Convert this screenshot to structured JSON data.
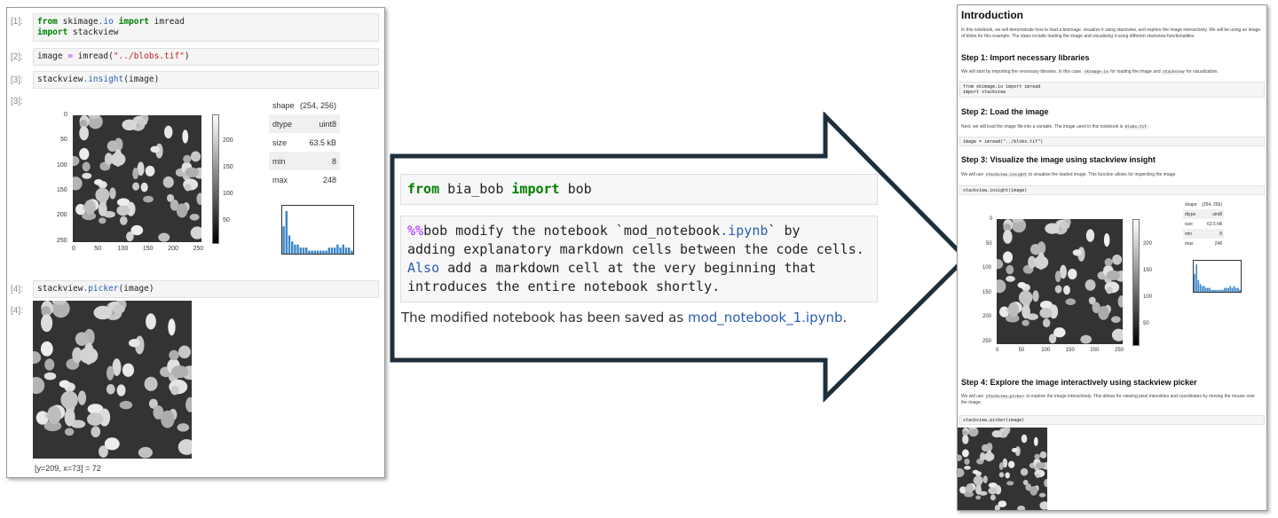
{
  "left_notebook": {
    "cells": [
      {
        "prompt": "[1]:",
        "lines": [
          [
            {
              "t": "from",
              "c": "kw"
            },
            {
              "t": " skimage"
            },
            {
              "t": ".io",
              "c": "mod"
            },
            {
              "t": " "
            },
            {
              "t": "import",
              "c": "kw"
            },
            {
              "t": " imread"
            }
          ],
          [
            {
              "t": "import",
              "c": "kw"
            },
            {
              "t": " stackview"
            }
          ]
        ]
      },
      {
        "prompt": "[2]:",
        "lines": [
          [
            {
              "t": "image "
            },
            {
              "t": "=",
              "c": "op"
            },
            {
              "t": " imread("
            },
            {
              "t": "\"../blobs.tif\"",
              "c": "str"
            },
            {
              "t": ")"
            }
          ]
        ]
      },
      {
        "prompt": "[3]:",
        "lines": [
          [
            {
              "t": "stackview"
            },
            {
              "t": ".insight",
              "c": "mod"
            },
            {
              "t": "(image)"
            }
          ]
        ]
      },
      {
        "prompt": "[4]:",
        "lines": [
          [
            {
              "t": "stackview"
            },
            {
              "t": ".picker",
              "c": "mod"
            },
            {
              "t": "(image)"
            }
          ]
        ]
      }
    ],
    "output_prompts": {
      "insight": "[3]:",
      "picker": "[4]:"
    },
    "insight_stats": [
      {
        "k": "shape",
        "v": "(254, 256)"
      },
      {
        "k": "dtype",
        "v": "uint8"
      },
      {
        "k": "size",
        "v": "63.5 kB"
      },
      {
        "k": "min",
        "v": "8"
      },
      {
        "k": "max",
        "v": "248"
      }
    ],
    "y_ticks": [
      "0",
      "50",
      "100",
      "150",
      "200",
      "250"
    ],
    "x_ticks": [
      "0",
      "50",
      "100",
      "150",
      "200",
      "250"
    ],
    "colorbar_ticks": [
      "200",
      "150",
      "100",
      "50"
    ],
    "picker_readout": "[y=209, x=73] = 72"
  },
  "middle": {
    "line1": [
      {
        "t": "from",
        "c": "kw"
      },
      {
        "t": " bia_bob "
      },
      {
        "t": "import",
        "c": "kw"
      },
      {
        "t": " bob"
      }
    ],
    "magic_lines": [
      [
        {
          "t": "%%",
          "c": "op"
        },
        {
          "t": "bob modify the notebook `mod_notebook"
        },
        {
          "t": ".ipynb",
          "c": "mod"
        },
        {
          "t": "` by"
        }
      ],
      [
        {
          "t": "adding explanatory markdown cells between the code cells."
        }
      ],
      [
        {
          "t": "Also",
          "c": "mod"
        },
        {
          "t": " add a markdown cell at the very beginning that"
        }
      ],
      [
        {
          "t": "introduces the entire notebook shortly."
        }
      ]
    ],
    "result_prefix": "The modified notebook has been saved as ",
    "result_link": "mod_notebook_1.ipynb",
    "result_suffix": "."
  },
  "right_notebook": {
    "intro_title": "Introduction",
    "intro_text": "In this notebook, we will demonstrate how to load a bioimage, visualize it using stackview, and explore the image interactively. We will be using an image of blobs for this example. The steps include loading the image and visualizing it using different stackview functionalities.",
    "step1_title": "Step 1: Import necessary libraries",
    "step1_text_a": "We will start by importing the necessary libraries. In this case, ",
    "step1_code_a": "skimage.io",
    "step1_text_b": " for loading the image and ",
    "step1_code_b": "stackview",
    "step1_text_c": " for visualization.",
    "step1_code": "from skimage.io import imread\nimport stackview",
    "step2_title": "Step 2: Load the image",
    "step2_text_a": "Next, we will load the image file into a variable. The image used in this notebook is ",
    "step2_code_a": "blobs.tif",
    "step2_text_b": ".",
    "step2_code": "image = imread(\"../blobs.tif\")",
    "step3_title": "Step 3: Visualize the image using stackview insight",
    "step3_text_a": "We will use ",
    "step3_code_a": "stackview.insight",
    "step3_text_b": " to visualize the loaded image. This function allows for inspecting the image.",
    "step3_code": "stackview.insight(image)",
    "step4_title": "Step 4: Explore the image interactively using stackview picker",
    "step4_text_a": "We will use ",
    "step4_code_a": "stackview.picker",
    "step4_text_b": " to explore the image interactively. This allows for viewing pixel intensities and coordinates by moving the mouse over the image.",
    "step4_code": "stackview.picker(image)"
  },
  "histogram_counts": [
    9,
    14,
    6,
    4,
    3,
    3,
    2,
    2,
    2,
    1,
    1,
    1,
    1,
    1,
    1,
    1,
    2,
    2,
    2,
    3,
    2,
    3,
    2,
    2,
    1
  ],
  "colors": {
    "keyword": "#008000",
    "module": "#2a5db0",
    "string": "#ba2121",
    "magic": "#aa22ff",
    "arrow_border": "#1e2f3b",
    "histogram": "#3a86c8"
  }
}
